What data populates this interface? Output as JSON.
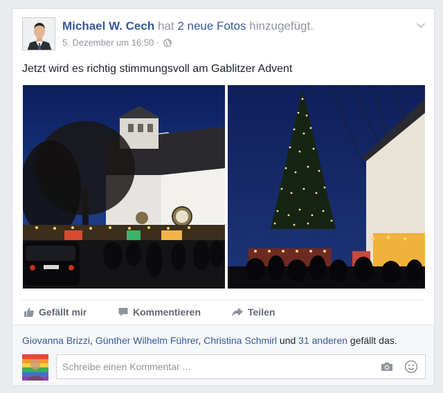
{
  "post": {
    "author": "Michael W. Cech",
    "action_prefix": "hat",
    "action_link": "2 neue Fotos",
    "action_suffix": "hinzugefügt.",
    "timestamp": "5. Dezember um 16:50",
    "separator": "·",
    "text": "Jetzt wird es richtig stimmungsvoll am Gablitzer Advent"
  },
  "photos": [
    {
      "icon": "church-evening-photo"
    },
    {
      "icon": "christmas-tree-photo"
    }
  ],
  "actions": {
    "like": "Gefällt mir",
    "comment": "Kommentieren",
    "share": "Teilen"
  },
  "likes": {
    "names": [
      "Giovanna Brizzi",
      "Günther Wilhelm Führer",
      "Christina Schmirl"
    ],
    "sep": ",",
    "and": "und",
    "others": "31 anderen",
    "suffix": "gefällt das."
  },
  "comment": {
    "placeholder": "Schreibe einen Kommentar ..."
  },
  "colors": {
    "link": "#365899",
    "muted": "#90949c",
    "text": "#1d2129"
  }
}
